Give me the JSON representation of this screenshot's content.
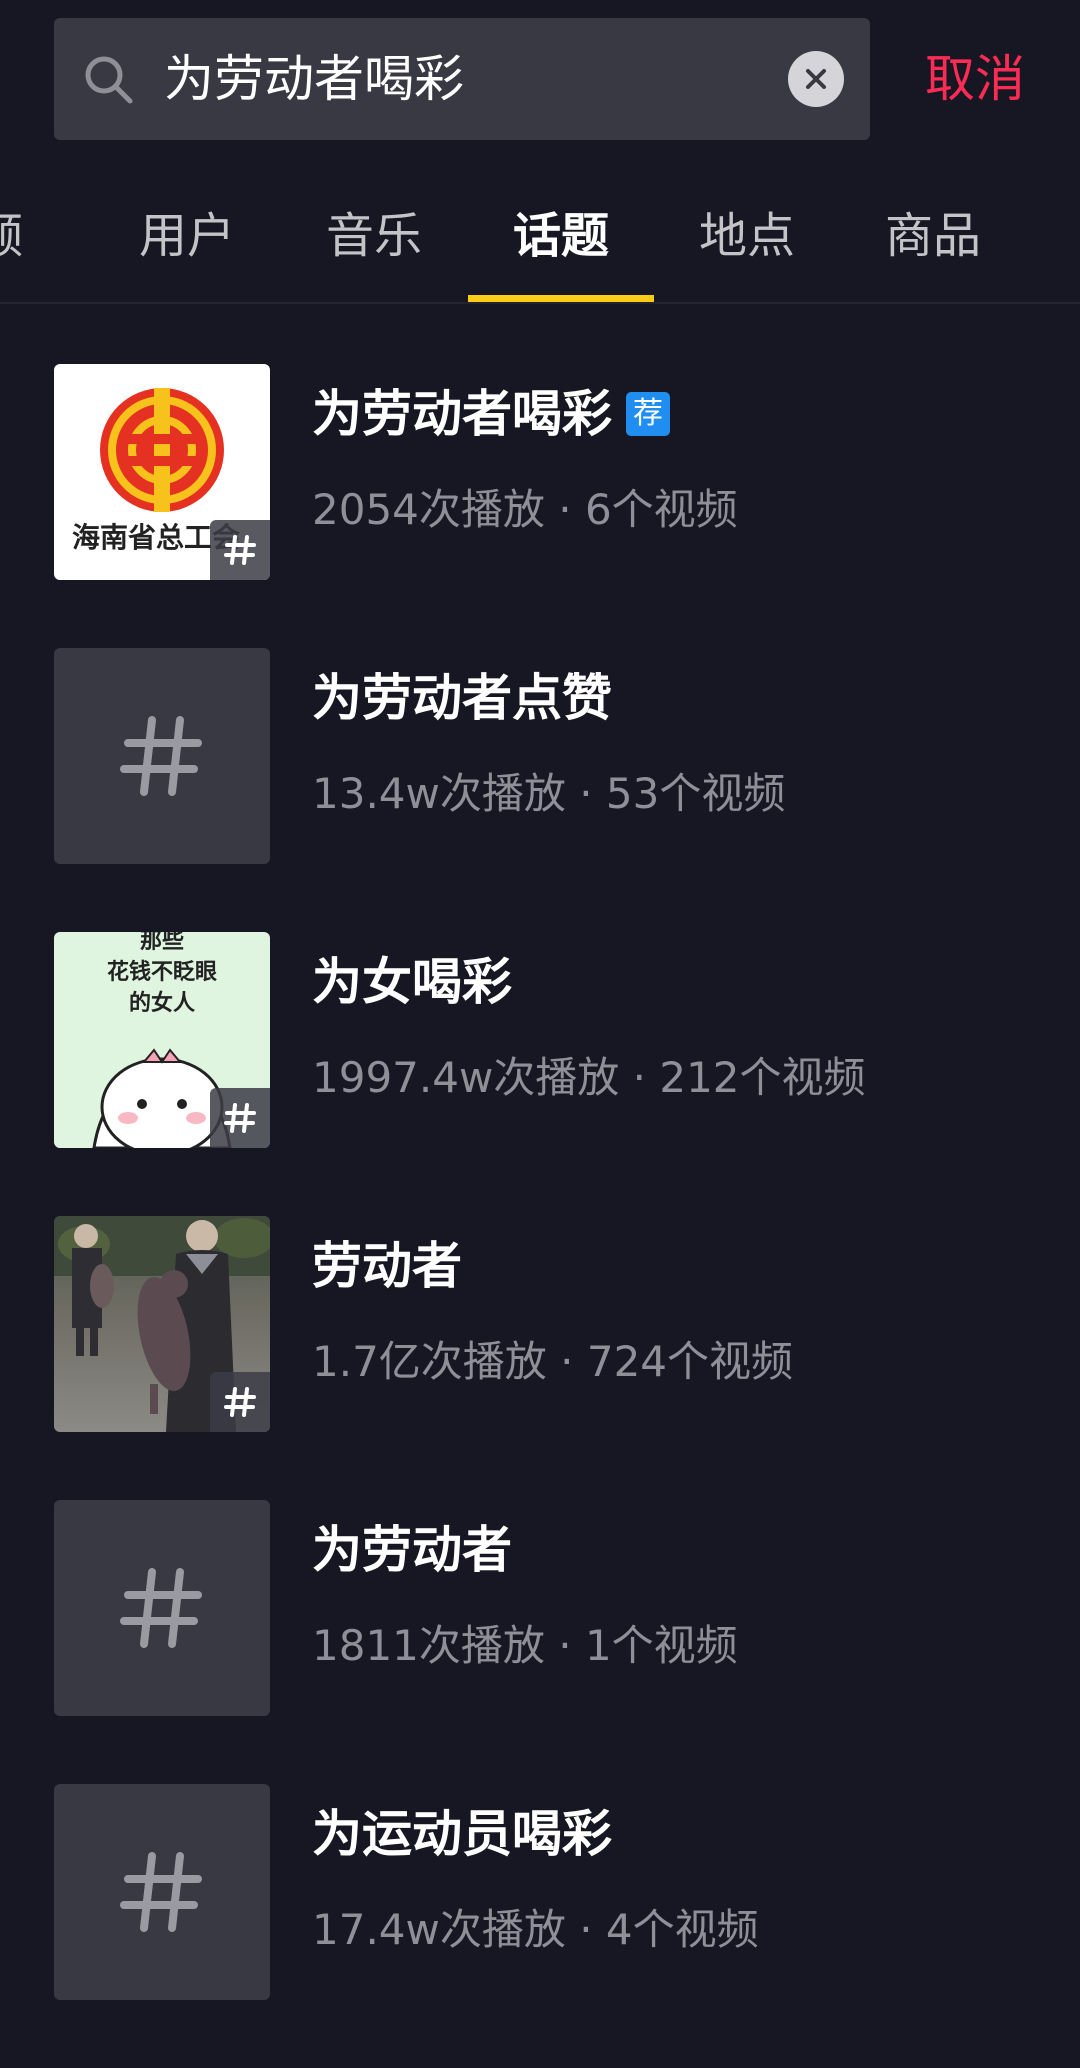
{
  "search": {
    "query": "为劳动者喝彩",
    "cancel_label": "取消"
  },
  "tabs": [
    {
      "label": "视频",
      "display": "频"
    },
    {
      "label": "用户"
    },
    {
      "label": "音乐"
    },
    {
      "label": "话题",
      "active": true
    },
    {
      "label": "地点"
    },
    {
      "label": "商品"
    }
  ],
  "topics": [
    {
      "title": "为劳动者喝彩",
      "badge": "荐",
      "stats": "2054次播放 · 6个视频",
      "thumbnail": "union-logo",
      "thumbnail_caption": "海南省总工会"
    },
    {
      "title": "为劳动者点赞",
      "stats": "13.4w次播放 · 53个视频",
      "thumbnail": "hashtag-placeholder"
    },
    {
      "title": "为女喝彩",
      "stats": "1997.4w次播放 · 212个视频",
      "thumbnail": "cartoon-girl",
      "thumbnail_caption_lines": [
        "那些",
        "花钱不眨眼",
        "的女人"
      ]
    },
    {
      "title": "劳动者",
      "stats": "1.7亿次播放 · 724个视频",
      "thumbnail": "photo-women-with-pig"
    },
    {
      "title": "为劳动者",
      "stats": "1811次播放 · 1个视频",
      "thumbnail": "hashtag-placeholder"
    },
    {
      "title": "为运动员喝彩",
      "stats": "17.4w次播放 · 4个视频",
      "thumbnail": "hashtag-placeholder"
    }
  ],
  "colors": {
    "background": "#161722",
    "accent_cancel": "#fe2c55",
    "tab_indicator": "#facc15",
    "recommend_badge": "#1f8ef0"
  }
}
